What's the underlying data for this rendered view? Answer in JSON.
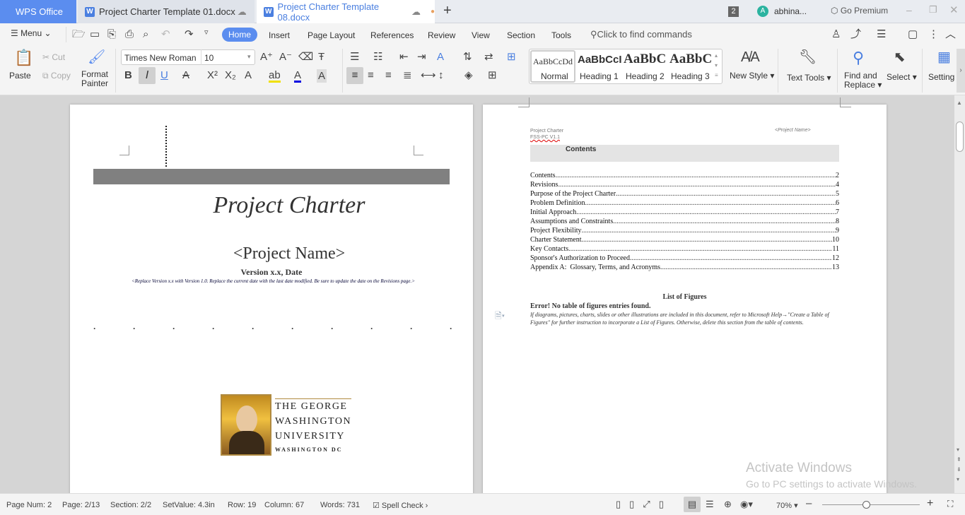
{
  "tabs": {
    "home": "WPS Office",
    "doc1": "Project Charter Template 01.docx",
    "doc2": "Project Charter Template 08.docx"
  },
  "titlebar": {
    "badge": "2",
    "user_initial": "A",
    "user": "abhina...",
    "premium": "Go Premium"
  },
  "menu": {
    "menu": "Menu",
    "items": [
      "Home",
      "Insert",
      "Page Layout",
      "References",
      "Review",
      "View",
      "Section",
      "Tools"
    ],
    "search_placeholder": "Click to find commands"
  },
  "toolbar": {
    "paste": "Paste",
    "cut": "Cut",
    "copy": "Copy",
    "format_painter_1": "Format",
    "format_painter_2": "Painter",
    "font": "Times New Roman",
    "size": "10",
    "new_style": "New Style",
    "text_tools": "Text Tools",
    "find_1": "Find and",
    "find_2": "Replace",
    "select": "Select",
    "setting": "Setting"
  },
  "styles": [
    {
      "preview": "AaBbCcDd",
      "name": "Normal"
    },
    {
      "preview": "AaBbCcI",
      "name": "Heading 1"
    },
    {
      "preview": "AaBbC",
      "name": "Heading 2"
    },
    {
      "preview": "AaBbC",
      "name": "Heading 3"
    }
  ],
  "page1": {
    "title": "Project Charter",
    "project_name": "<Project Name>",
    "version": "Version x.x, Date",
    "note": "<Replace Version x.x with Version 1.0. Replace the current date with the last date modified. Be sure to update the date on the Revisions page.>",
    "logo_text": [
      "THE GEORGE",
      "WASHINGTON",
      "UNIVERSITY",
      "WASHINGTON DC"
    ]
  },
  "page2": {
    "header_left_1": "Project Charter",
    "header_left_2": "FSS-PC V1.1",
    "header_right": "<Project Name>",
    "contents_title": "Contents",
    "toc": [
      {
        "t": "Contents",
        "p": "2"
      },
      {
        "t": "Revisions",
        "p": "4"
      },
      {
        "t": "Purpose of the Project Charter",
        "p": "5"
      },
      {
        "t": "Problem Definition",
        "p": "6"
      },
      {
        "t": "Initial Approach",
        "p": "7"
      },
      {
        "t": "Assumptions and Constraints",
        "p": "8"
      },
      {
        "t": "Project Flexibility",
        "p": "9"
      },
      {
        "t": "Charter Statement",
        "p": "10"
      },
      {
        "t": "Key Contacts",
        "p": "11"
      },
      {
        "t": "Sponsor's Authorization to Proceed",
        "p": "12"
      },
      {
        "t": "Appendix A:  Glossary, Terms, and Acronyms",
        "p": "13"
      }
    ],
    "lof_title": "List of Figures",
    "lof_error": "Error! No table of figures entries found.",
    "lof_note": "If diagrams, pictures, charts, slides or other illustrations are included in this document, refer to Microsoft Help→\"Create a Table of Figures\" for further instruction to incorporate a List of Figures. Otherwise, delete this section from the table of contents."
  },
  "watermark": {
    "line1": "Activate Windows",
    "line2": "Go to PC settings to activate Windows."
  },
  "status": {
    "page_num": "Page Num: 2",
    "page": "Page: 2/13",
    "section": "Section: 2/2",
    "setvalue": "SetValue: 4.3in",
    "row": "Row: 19",
    "column": "Column: 67",
    "words": "Words: 731",
    "spell": "Spell Check",
    "zoom": "70%",
    "zoom_percent": 70
  }
}
